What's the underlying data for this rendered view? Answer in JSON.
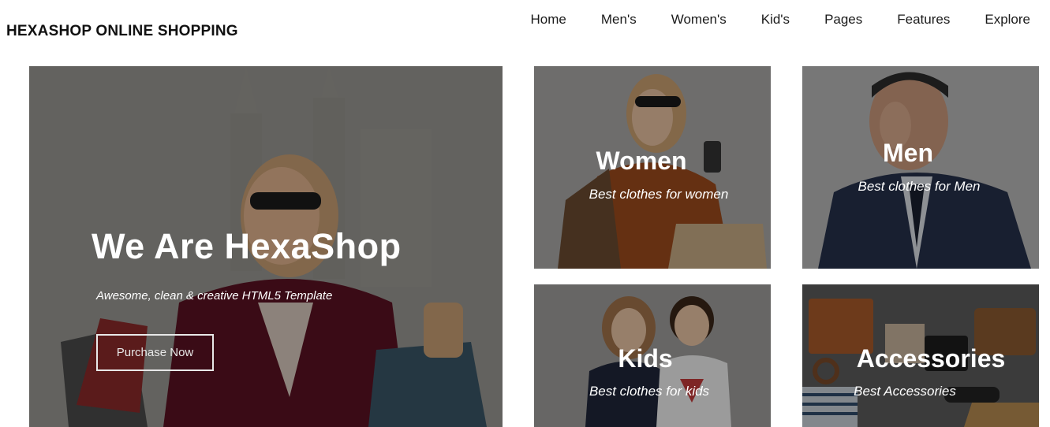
{
  "header": {
    "logo": "HEXASHOP ONLINE SHOPPING",
    "nav": [
      "Home",
      "Men's",
      "Women's",
      "Kid's",
      "Pages",
      "Features",
      "Explore"
    ]
  },
  "hero": {
    "title": "We Are HexaShop",
    "subtitle": "Awesome, clean & creative HTML5 Template",
    "button": "Purchase Now"
  },
  "categories": [
    {
      "title": "Women",
      "subtitle": "Best clothes for women"
    },
    {
      "title": "Men",
      "subtitle": "Best clothes for Men"
    },
    {
      "title": "Kids",
      "subtitle": "Best clothes for kids"
    },
    {
      "title": "Accessories",
      "subtitle": "Best Accessories"
    }
  ]
}
